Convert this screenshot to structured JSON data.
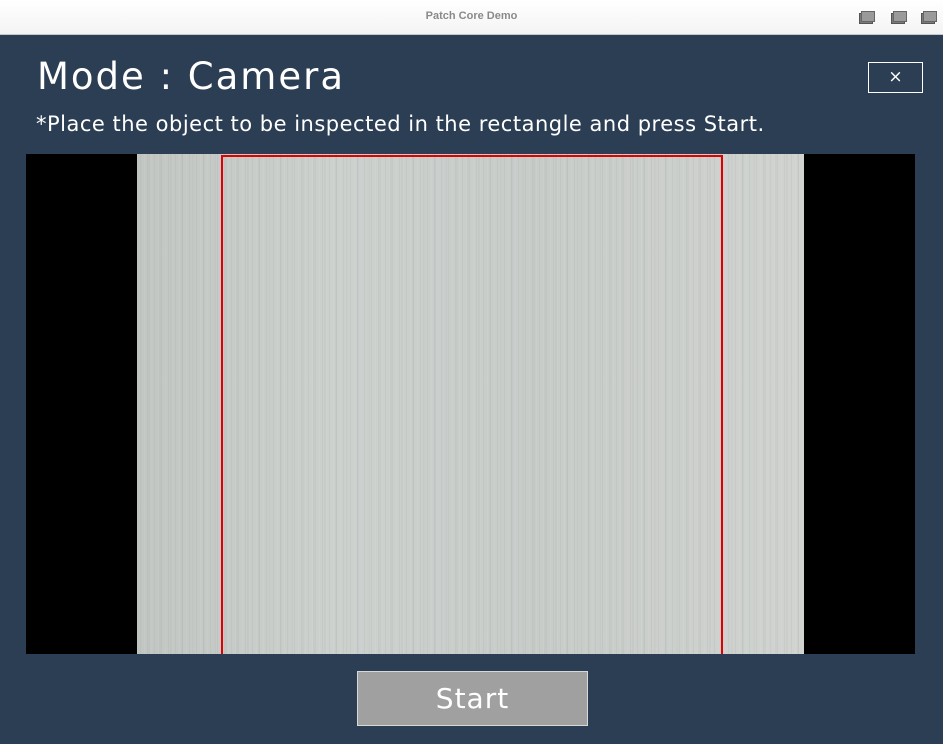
{
  "window": {
    "title": "Patch Core Demo",
    "controls": [
      "minimize-icon",
      "maximize-icon",
      "close-window-icon"
    ]
  },
  "header": {
    "mode_title": "Mode : Camera",
    "close_label": "×",
    "instruction": "*Place the object to be inspected in the rectangle and press Start."
  },
  "camera": {
    "feed": "live-camera-preview",
    "rect_color": "#e00000"
  },
  "footer": {
    "start_label": "Start"
  },
  "colors": {
    "background": "#2c3e53",
    "button": "#a0a0a0",
    "accent": "#e00000"
  }
}
